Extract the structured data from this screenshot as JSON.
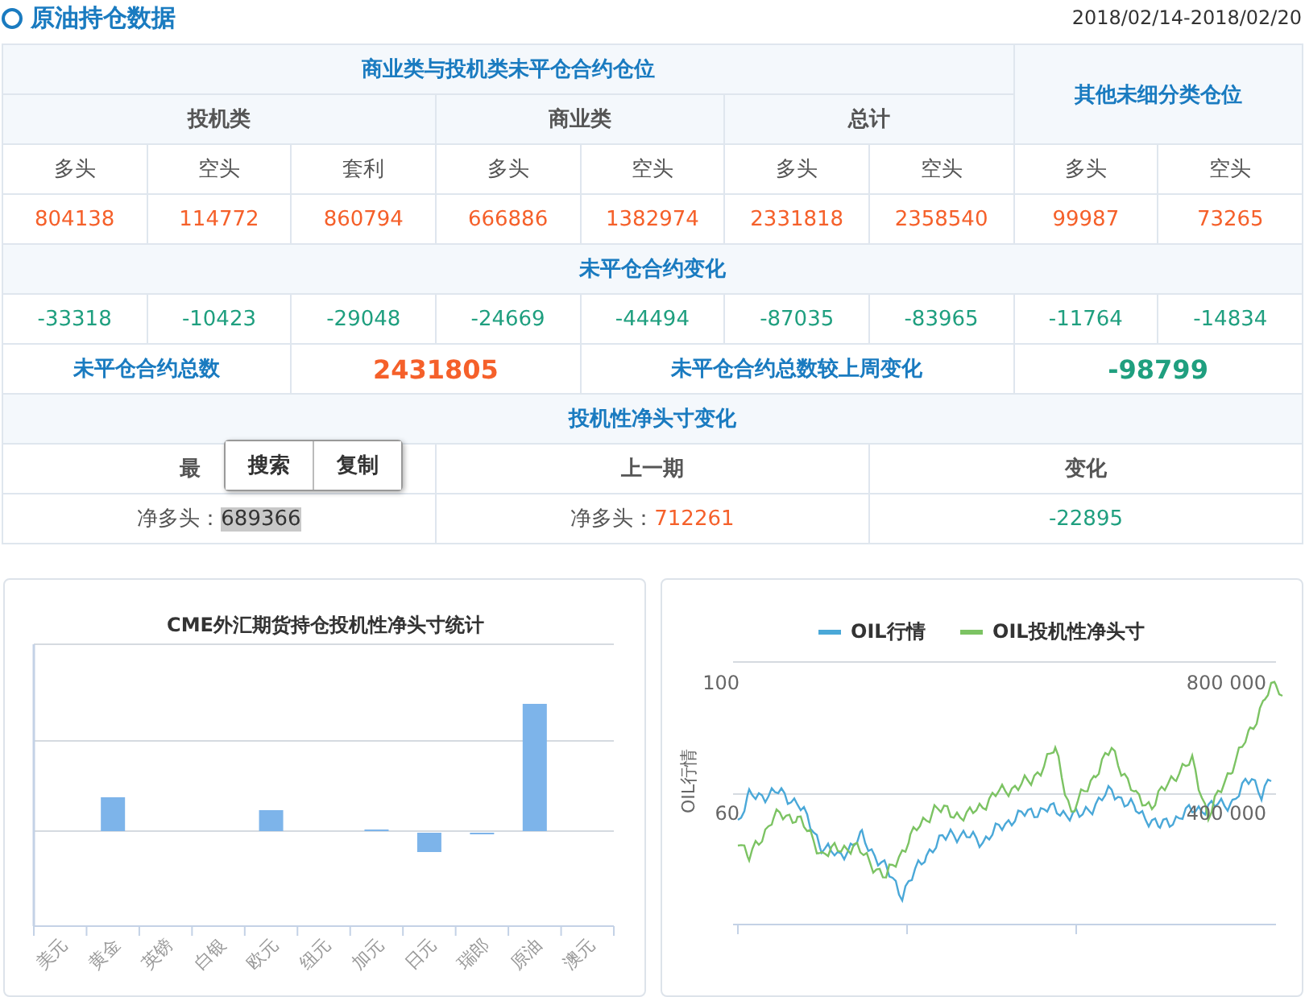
{
  "header": {
    "title": "原油持仓数据",
    "date_range": "2018/02/14-2018/02/20"
  },
  "positions_table": {
    "group_header": "商业类与投机类未平仓合约仓位",
    "other_header": "其他未细分类仓位",
    "groups": [
      "投机类",
      "商业类",
      "总计"
    ],
    "subheaders": [
      "多头",
      "空头",
      "套利",
      "多头",
      "空头",
      "多头",
      "空头",
      "多头",
      "空头"
    ],
    "values": [
      "804138",
      "114772",
      "860794",
      "666886",
      "1382974",
      "2331818",
      "2358540",
      "99987",
      "73265"
    ],
    "change_title": "未平仓合约变化",
    "changes": [
      "-33318",
      "-10423",
      "-29048",
      "-24669",
      "-44494",
      "-87035",
      "-83965",
      "-11764",
      "-14834"
    ],
    "totals": {
      "label": "未平仓合约总数",
      "value": "2431805",
      "change_label": "未平仓合约总数较上周变化",
      "change_value": "-98799"
    },
    "net_title": "投机性净头寸变化",
    "net_headers": [
      "最",
      "上一期",
      "变化"
    ],
    "net_values": [
      {
        "label": "净多头：",
        "value": "689366",
        "selected": true
      },
      {
        "label": "净多头：",
        "value": "712261",
        "selected": false
      },
      {
        "value": "-22895"
      }
    ]
  },
  "context_menu": {
    "items": [
      "搜索",
      "复制"
    ]
  },
  "bar_chart": {
    "title": "CME外汇期货持仓投机性净头寸统计",
    "categories": [
      "美元",
      "黄金",
      "英镑",
      "白银",
      "欧元",
      "纽元",
      "加元",
      "日元",
      "瑞郎",
      "原油",
      "澳元"
    ]
  },
  "line_chart": {
    "legend": [
      {
        "label": "OIL行情",
        "color": "#4aa8d8"
      },
      {
        "label": "OIL投机性净头寸",
        "color": "#7cc363"
      }
    ],
    "left_ticks": [
      "100",
      "60"
    ],
    "right_ticks": [
      "800 000",
      "400 000"
    ],
    "y_label": "OIL行情"
  }
}
